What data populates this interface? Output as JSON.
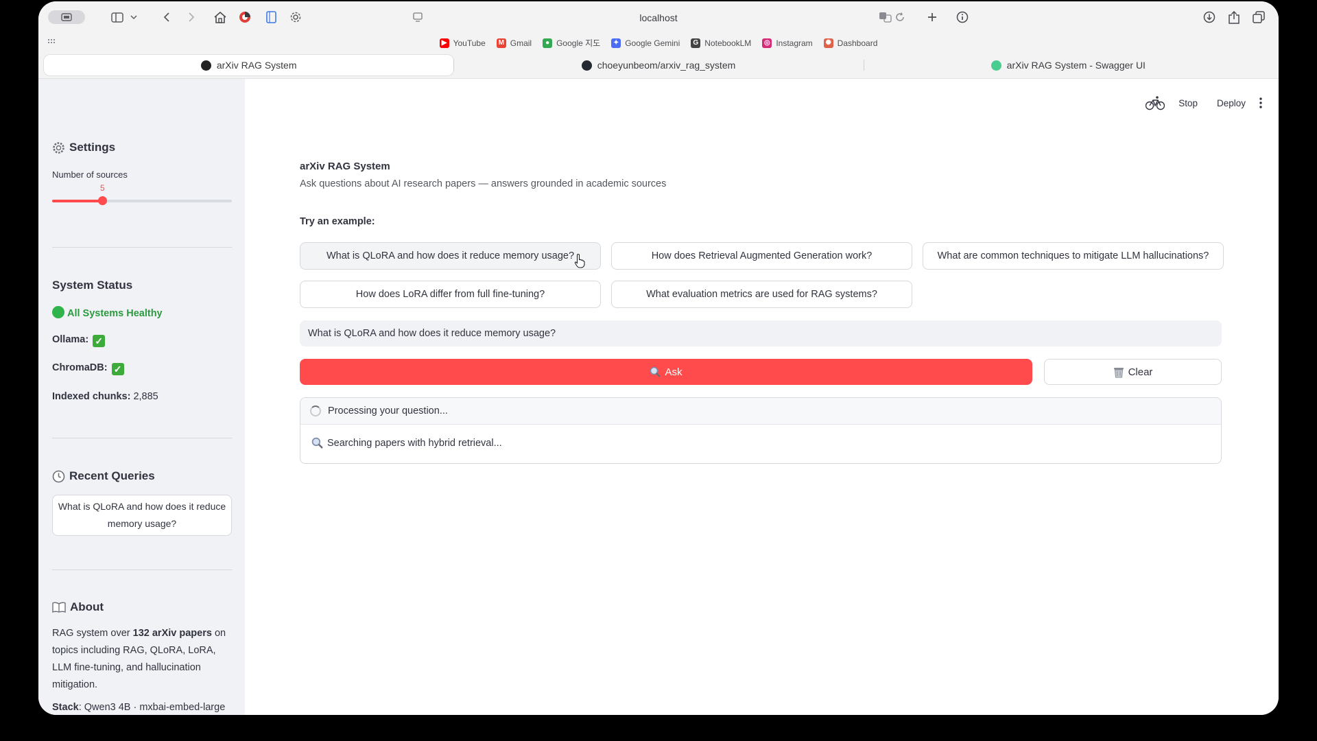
{
  "browser": {
    "address": "localhost",
    "bookmarks": [
      {
        "label": "YouTube",
        "color": "#ff0000",
        "glyph": "▶"
      },
      {
        "label": "Gmail",
        "color": "#ea4335",
        "glyph": "M"
      },
      {
        "label": "Google 지도",
        "color": "#34a853",
        "glyph": "●"
      },
      {
        "label": "Google Gemini",
        "color": "#4a6cf7",
        "glyph": "✦"
      },
      {
        "label": "NotebookLM",
        "color": "#444444",
        "glyph": "G"
      },
      {
        "label": "Instagram",
        "color": "#d62976",
        "glyph": "◎"
      },
      {
        "label": "Dashboard",
        "color": "#e0604a",
        "glyph": "✺"
      }
    ],
    "tabs": [
      {
        "label": "arXiv RAG System",
        "icon_color": "#222222",
        "active": true
      },
      {
        "label": "choeyunbeom/arxiv_rag_system",
        "icon_color": "#24292f",
        "active": false
      },
      {
        "label": "arXiv RAG System - Swagger UI",
        "icon_color": "#49cc90",
        "active": false
      }
    ]
  },
  "sidebar": {
    "settings_title": "Settings",
    "sources_label": "Number of sources",
    "sources_value": "5",
    "sources_fraction": 0.28,
    "status_title": "System Status",
    "healthy_text": "All Systems Healthy",
    "ollama_label": "Ollama:",
    "chromadb_label": "ChromaDB:",
    "chunks_label": "Indexed chunks:",
    "chunks_value": "2,885",
    "recent_title": "Recent Queries",
    "recent_item": "What is QLoRA and how does it reduce memory usage?",
    "about_title": "About",
    "about_pre": "RAG system over ",
    "about_bold": "132 arXiv papers",
    "about_post": " on topics including RAG, QLoRA, LoRA, LLM fine-tuning, and hallucination mitigation.",
    "stack_label": "Stack",
    "stack_value": ": Qwen3 4B · mxbai-embed-large"
  },
  "header": {
    "stop_label": "Stop",
    "deploy_label": "Deploy"
  },
  "main": {
    "title": "arXiv RAG System",
    "subtitle": "Ask questions about AI research papers — answers grounded in academic sources",
    "try_label": "Try an example:",
    "examples": [
      "What is QLoRA and how does it reduce memory usage?",
      "How does Retrieval Augmented Generation work?",
      "What are common techniques to mitigate LLM hallucinations?",
      "How does LoRA differ from full fine-tuning?",
      "What evaluation metrics are used for RAG systems?"
    ],
    "query_value": "What is QLoRA and how does it reduce memory usage?",
    "ask_label": "Ask",
    "clear_label": "Clear",
    "processing_text": "Processing your question...",
    "searching_text": "Searching papers with hybrid retrieval..."
  },
  "colors": {
    "accent": "#ff4b4b",
    "healthy": "#2fb34a",
    "sidebar_bg": "#f0f2f6"
  }
}
